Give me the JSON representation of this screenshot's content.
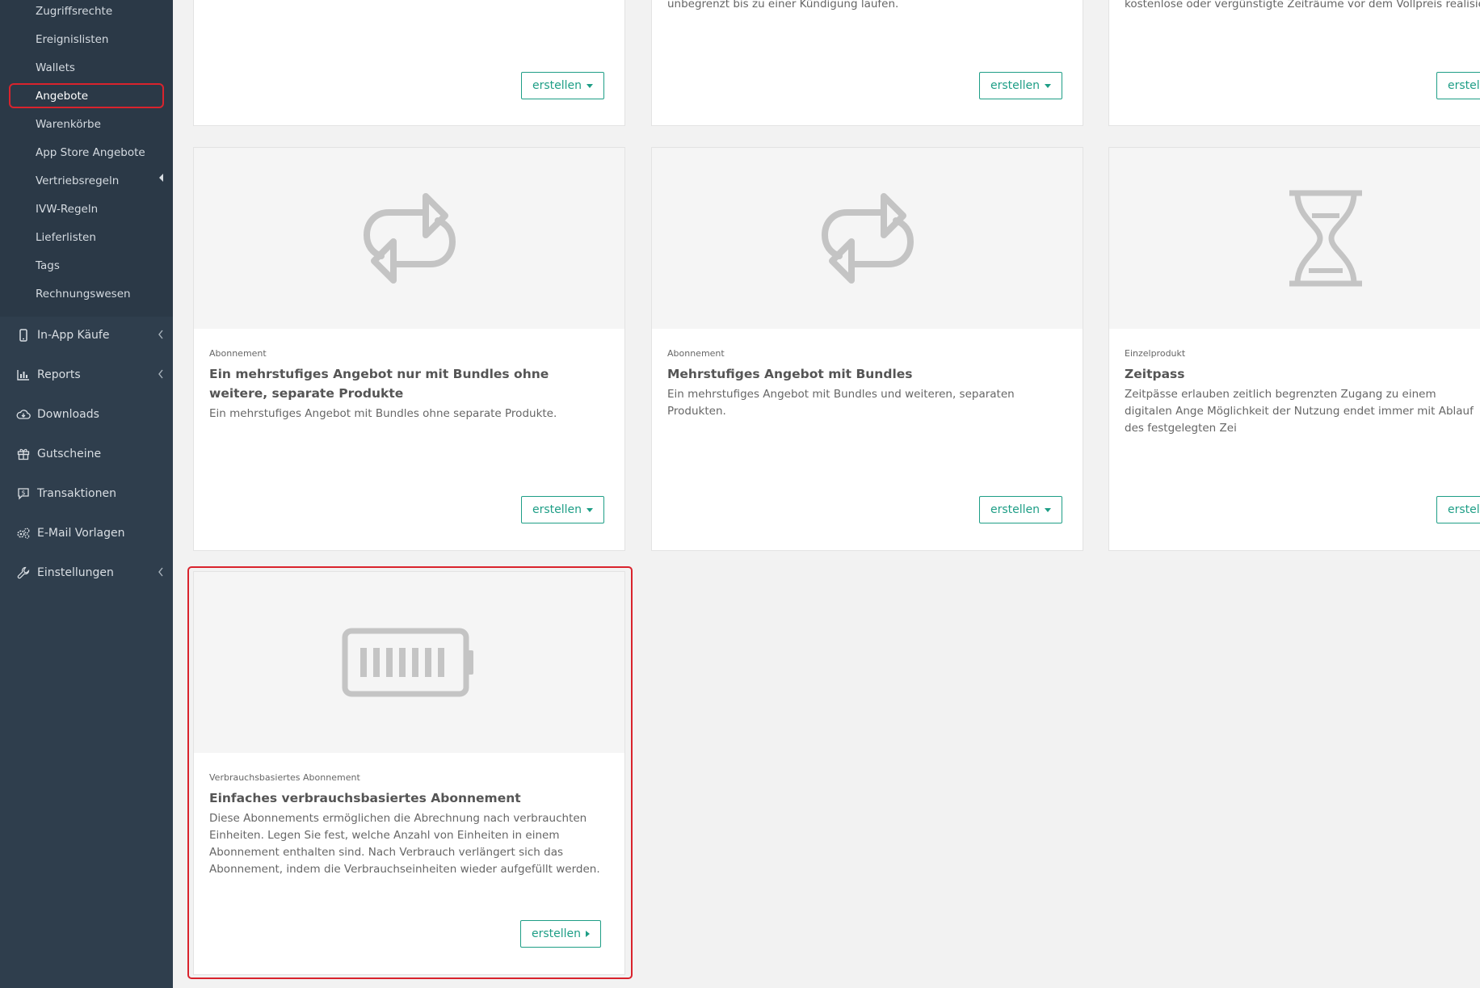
{
  "sidebar": {
    "submenu": [
      {
        "label": "Zugriffsrechte"
      },
      {
        "label": "Ereignislisten"
      },
      {
        "label": "Wallets"
      },
      {
        "label": "Angebote"
      },
      {
        "label": "Warenkörbe"
      },
      {
        "label": "App Store Angebote"
      },
      {
        "label": "Vertriebsregeln"
      },
      {
        "label": "IVW-Regeln"
      },
      {
        "label": "Lieferlisten"
      },
      {
        "label": "Tags"
      },
      {
        "label": "Rechnungswesen"
      }
    ],
    "active_item": "Angebote",
    "nav": [
      {
        "label": "In-App Käufe",
        "icon": "mobile-icon"
      },
      {
        "label": "Reports",
        "icon": "bar-chart-icon"
      },
      {
        "label": "Downloads",
        "icon": "cloud-download-icon"
      },
      {
        "label": "Gutscheine",
        "icon": "gift-icon"
      },
      {
        "label": "Transaktionen",
        "icon": "dollar-message-icon"
      },
      {
        "label": "E-Mail Vorlagen",
        "icon": "cogs-icon"
      },
      {
        "label": "Einstellungen",
        "icon": "wrench-icon"
      }
    ]
  },
  "cards": {
    "row1": [
      {
        "desc": "",
        "button": "erstellen"
      },
      {
        "desc": "unbegrenzt bis zu einer Kündigung laufen.",
        "button": "erstellen"
      },
      {
        "desc": "kostenlose oder vergünstigte Zeiträume vor dem Vollpreis realisiert.",
        "button": "erstell"
      }
    ],
    "row2": [
      {
        "category": "Abonnement",
        "title": "Ein mehrstufiges Angebot nur mit Bundles ohne weitere, separate Produkte",
        "desc": "Ein mehrstufiges Angebot mit Bundles ohne separate Produkte.",
        "button": "erstellen",
        "icon": "repeat-icon"
      },
      {
        "category": "Abonnement",
        "title": "Mehrstufiges Angebot mit Bundles",
        "desc": "Ein mehrstufiges Angebot mit Bundles und weiteren, separaten Produkten.",
        "button": "erstellen",
        "icon": "repeat-icon"
      },
      {
        "category": "Einzelprodukt",
        "title": "Zeitpass",
        "desc": "Zeitpässe erlauben zeitlich begrenzten Zugang zu einem digitalen Ange Möglichkeit der Nutzung endet immer mit Ablauf des festgelegten Zei",
        "button": "erstell",
        "icon": "hourglass-icon"
      }
    ],
    "row3": [
      {
        "category": "Verbrauchsbasiertes Abonnement",
        "title": "Einfaches verbrauchsbasiertes Abonnement",
        "desc": "Diese Abonnements ermöglichen die Abrechnung nach verbrauchten Einheiten. Legen Sie fest, welche Anzahl von Einheiten in einem Abonnement enthalten sind. Nach Verbrauch verlängert sich das Abonnement, indem die Verbrauchseinheiten wieder aufgefüllt werden.",
        "button": "erstellen",
        "icon": "battery-icon"
      }
    ]
  },
  "colors": {
    "sidebar_bg": "#2f3e4d",
    "accent": "#1e9e86",
    "highlight": "#d9232d",
    "icon_gray": "#c4c4c4"
  }
}
